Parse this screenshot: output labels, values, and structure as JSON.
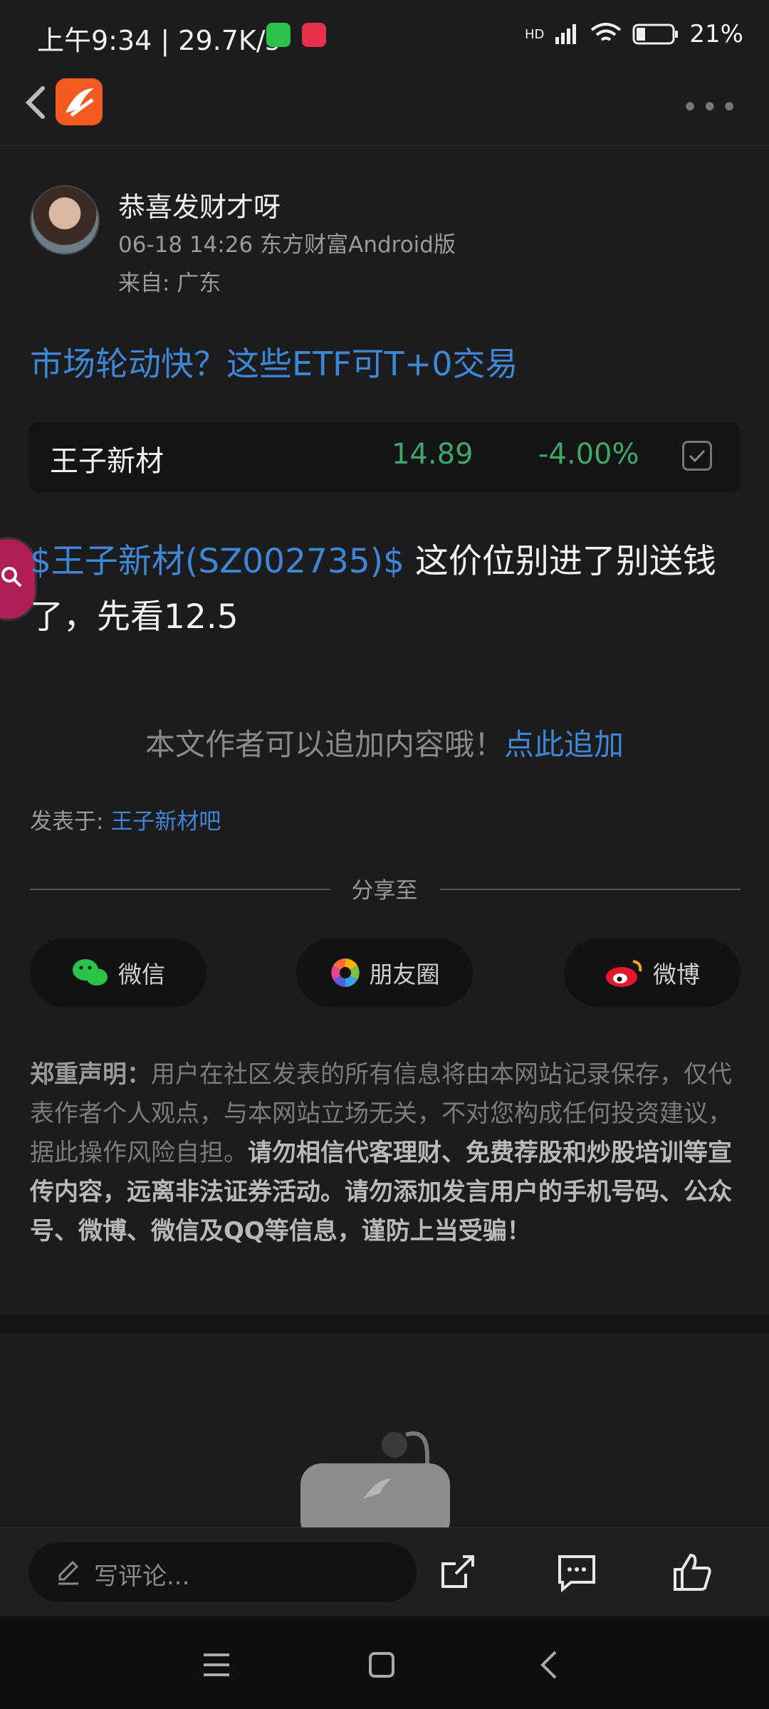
{
  "status_bar": {
    "time": "上午9:34 | 29.7K/s",
    "battery": "21%",
    "network_label": "HD"
  },
  "post": {
    "author_name": "恭喜发财才呀",
    "meta": "06-18 14:26 东方财富Android版",
    "from": "来自: 广东",
    "title": "市场轮动快？这些ETF可T+0交易",
    "stock": {
      "name": "王子新材",
      "price": "14.89",
      "change": "-4.00%"
    },
    "tag": "$王子新材(SZ002735)$",
    "body": " 这价位别进了别送钱了，先看12.5",
    "add_prompt": "本文作者可以追加内容哦！",
    "add_link": "点此追加",
    "posted_label": "发表于: ",
    "posted_forum": "王子新材吧"
  },
  "share": {
    "label": "分享至",
    "wechat": "微信",
    "moments": "朋友圈",
    "weibo": "微博"
  },
  "disclaimer": {
    "heading": "郑重声明：",
    "normal": "用户在社区发表的所有信息将由本网站记录保存，仅代表作者个人观点，与本网站立场无关，不对您构成任何投资建议，据此操作风险自担。",
    "bold": "请勿相信代客理财、免费荐股和炒股培训等宣传内容，远离非法证券活动。请勿添加发言用户的手机号码、公众号、微博、微信及QQ等信息，谨防上当受骗！"
  },
  "comment_bar": {
    "placeholder": "写评论..."
  },
  "colors": {
    "link": "#3e86d6",
    "down": "#3fa866",
    "brand": "#f25a1f"
  }
}
